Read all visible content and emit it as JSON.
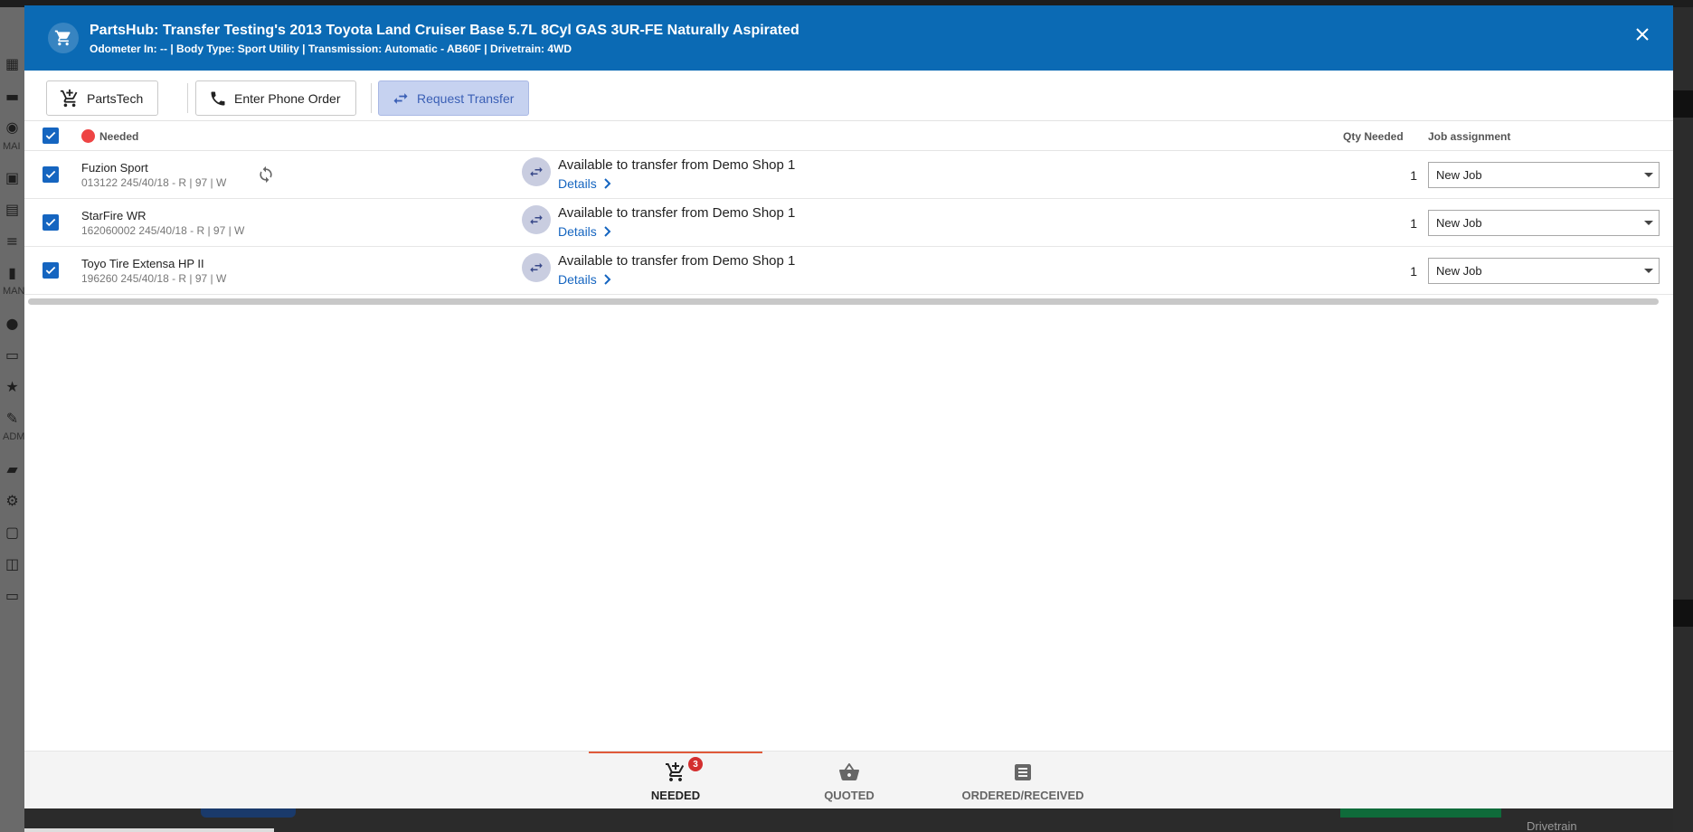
{
  "modal": {
    "title": "PartsHub: Transfer Testing's 2013 Toyota Land Cruiser Base 5.7L 8Cyl GAS 3UR-FE Naturally Aspirated",
    "subtitle": "Odometer In: -- | Body Type:  Sport Utility | Transmission: Automatic - AB60F | Drivetrain: 4WD"
  },
  "toolbar": {
    "partstech_label": "PartsTech",
    "phone_order_label": "Enter Phone Order",
    "request_transfer_label": "Request Transfer"
  },
  "table": {
    "status_label": "Needed",
    "qty_header": "Qty Needed",
    "job_header": "Job assignment",
    "rows": [
      {
        "name": "Fuzion Sport",
        "spec": "013122 245/40/18 - R | 97 | W",
        "availability": "Available to transfer from Demo Shop 1",
        "details_label": "Details",
        "qty": "1",
        "job": "New Job"
      },
      {
        "name": "StarFire WR",
        "spec": "162060002 245/40/18 - R | 97 | W",
        "availability": "Available to transfer from Demo Shop 1",
        "details_label": "Details",
        "qty": "1",
        "job": "New Job"
      },
      {
        "name": "Toyo Tire Extensa HP II",
        "spec": "196260 245/40/18 - R | 97 | W",
        "availability": "Available to transfer from Demo Shop 1",
        "details_label": "Details",
        "qty": "1",
        "job": "New Job"
      }
    ]
  },
  "tabs": {
    "needed_label": "NEEDED",
    "needed_count": "3",
    "quoted_label": "QUOTED",
    "ordered_label": "ORDERED/RECEIVED"
  },
  "background": {
    "sidebar_labels": [
      "MAI",
      "MAN",
      "ADM"
    ],
    "bottom_text": "Drivetrain"
  },
  "colors": {
    "header": "#0b6ab4",
    "accent": "#1565c0",
    "needed_dot": "#ee4444",
    "active_tab_line": "#e05a3a"
  }
}
